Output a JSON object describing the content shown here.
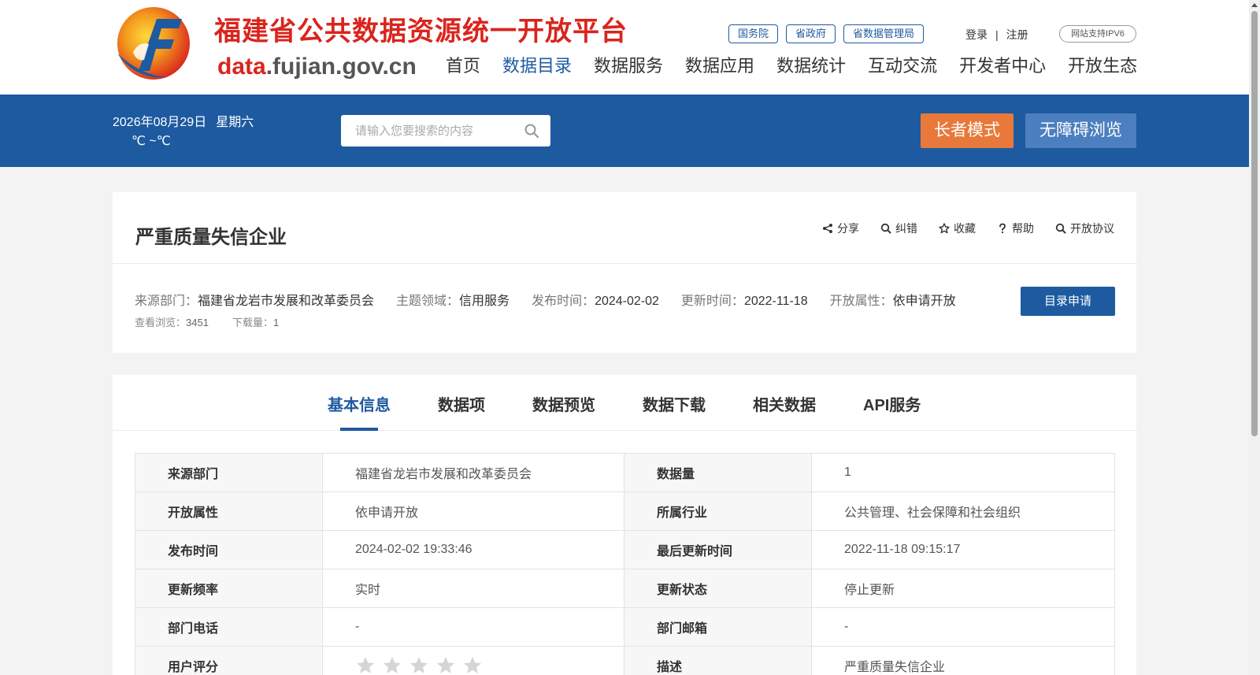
{
  "header": {
    "logo_title": "福建省公共数据资源统一开放平台",
    "logo_domain_prefix": "data",
    "logo_domain_suffix": ".fujian.gov.cn",
    "gov_links": [
      "国务院",
      "省政府",
      "省数据管理局"
    ],
    "login": "登录",
    "separator": "|",
    "register": "注册",
    "ipv6_badge": "网站支持IPV6",
    "nav": [
      "首页",
      "数据目录",
      "数据服务",
      "数据应用",
      "数据统计",
      "互动交流",
      "开发者中心",
      "开放生态"
    ],
    "active_nav": "数据目录"
  },
  "band": {
    "date": "2026年08月29日",
    "weekday": "星期六",
    "temperature": "℃ ~℃",
    "search_placeholder": "请输入您要搜索的内容",
    "elder_mode": "长者模式",
    "accessible": "无障碍浏览"
  },
  "dataset": {
    "title": "严重质量失信企业",
    "actions": [
      {
        "label": "分享",
        "icon": "share-icon"
      },
      {
        "label": "纠错",
        "icon": "search-icon"
      },
      {
        "label": "收藏",
        "icon": "star-icon"
      },
      {
        "label": "帮助",
        "icon": "question-icon"
      },
      {
        "label": "开放协议",
        "icon": "search-icon"
      }
    ],
    "meta": {
      "source_label": "来源部门：",
      "source": "福建省龙岩市发展和改革委员会",
      "topic_label": "主题领域：",
      "topic": "信用服务",
      "publish_label": "发布时间：",
      "publish": "2024-02-02",
      "update_label": "更新时间：",
      "update": "2022-11-18",
      "open_label": "开放属性：",
      "open": "依申请开放"
    },
    "stats": {
      "views_label": "查看浏览：",
      "views": "3451",
      "downloads_label": "下载量：",
      "downloads": "1"
    },
    "apply_button": "目录申请"
  },
  "tabs": [
    "基本信息",
    "数据项",
    "数据预览",
    "数据下载",
    "相关数据",
    "API服务"
  ],
  "active_tab": "基本信息",
  "info_rows": [
    {
      "k1": "来源部门",
      "v1": "福建省龙岩市发展和改革委员会",
      "k2": "数据量",
      "v2": "1"
    },
    {
      "k1": "开放属性",
      "v1": "依申请开放",
      "k2": "所属行业",
      "v2": "公共管理、社会保障和社会组织"
    },
    {
      "k1": "发布时间",
      "v1": "2024-02-02 19:33:46",
      "k2": "最后更新时间",
      "v2": "2022-11-18 09:15:17"
    },
    {
      "k1": "更新频率",
      "v1": "实时",
      "k2": "更新状态",
      "v2": "停止更新"
    },
    {
      "k1": "部门电话",
      "v1": "-",
      "k2": "部门邮箱",
      "v2": "-"
    },
    {
      "k1": "用户评分",
      "v1": "",
      "k2": "描述",
      "v2": "严重质量失信企业"
    }
  ],
  "user_rating": {
    "value": 0,
    "max": 5
  },
  "colors": {
    "brand_red": "#d9251d",
    "brand_blue": "#1d5aa0",
    "elder_orange": "#e8793a",
    "accessible_blue": "#4b7fc0"
  }
}
